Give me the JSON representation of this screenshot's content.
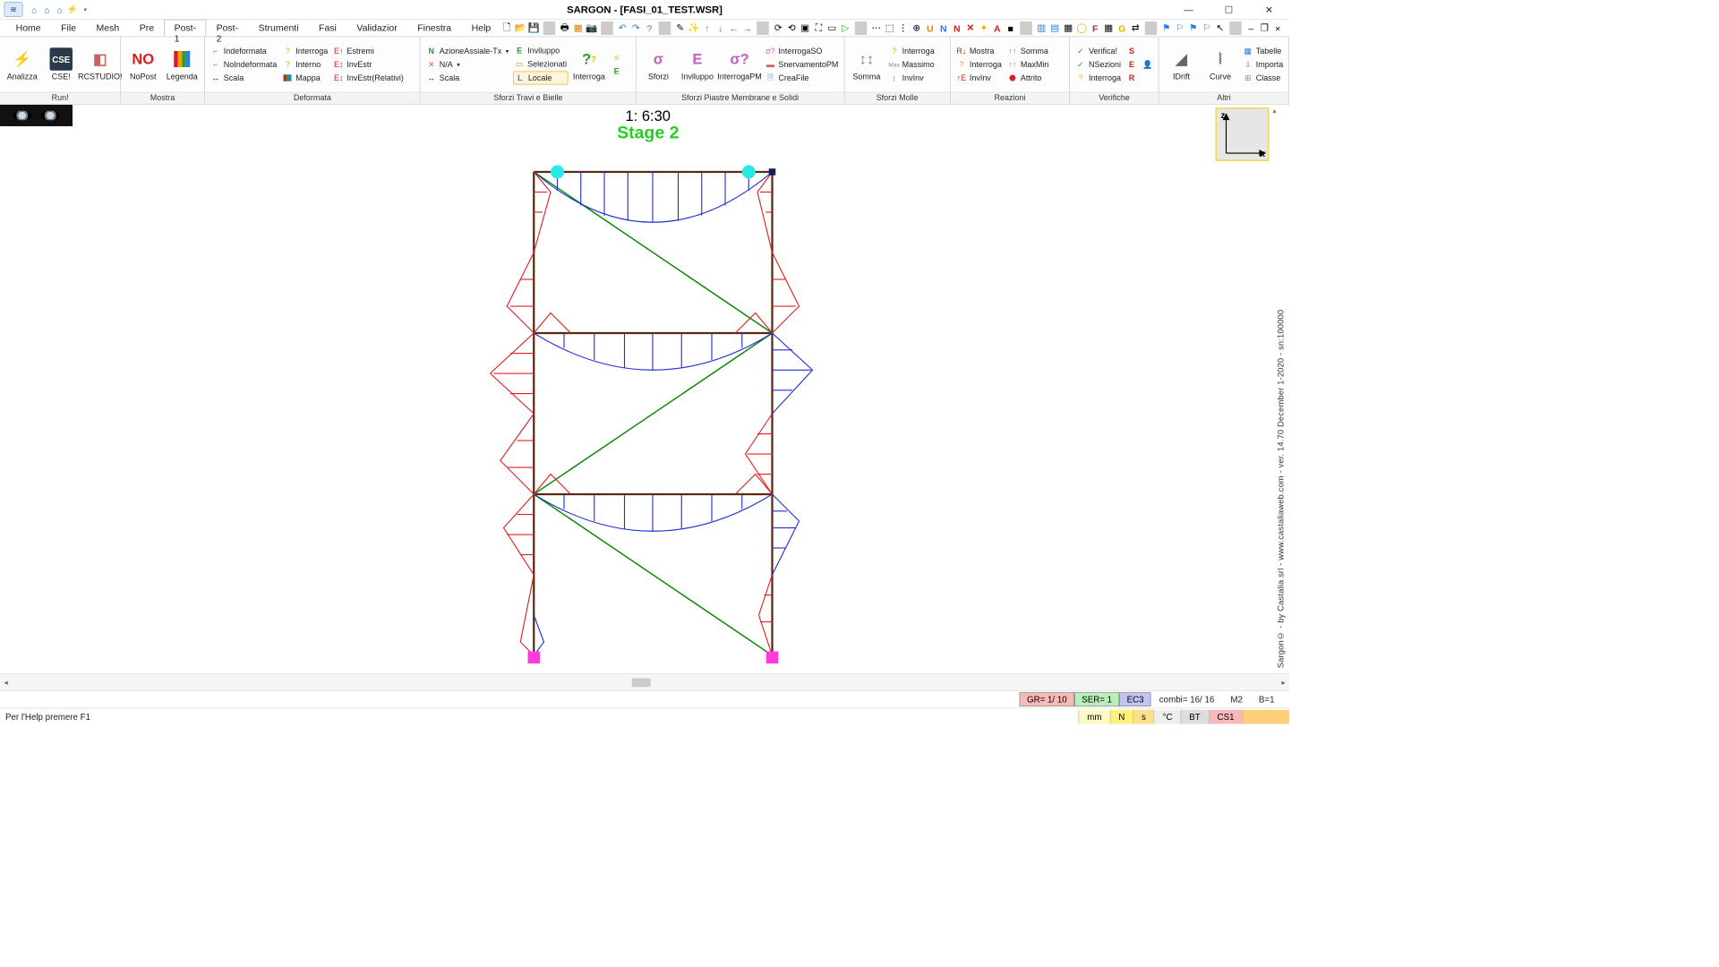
{
  "title": "SARGON - [FASI_01_TEST.WSR]",
  "menu": [
    "Home",
    "File",
    "Mesh",
    "Pre",
    "Post-1",
    "Post-2",
    "Strumenti",
    "Fasi",
    "Validazior",
    "Finestra",
    "Help"
  ],
  "menu_active": "Post-1",
  "groups": {
    "run": {
      "label": "Run!",
      "btns": [
        "Analizza",
        "CSE!",
        "RCSTUDIO!"
      ]
    },
    "mostra": {
      "label": "Mostra",
      "btns": [
        "NoPost",
        "Legenda"
      ]
    },
    "deformata": {
      "label": "Deformata",
      "c1": [
        "Indeformata",
        "NoIndeformata",
        "Scala"
      ],
      "c2": [
        "Interroga",
        "Interno",
        "Mappa"
      ],
      "c3": [
        "Estremi",
        "InvEstr",
        "InvEstr(Relativi)"
      ]
    },
    "sforzi_tb": {
      "label": "Sforzi Travi e Bielle",
      "c1": [
        "AzioneAssiale-Tx",
        "N/A",
        "Scala"
      ],
      "c2": [
        "Inviluppo",
        "Selezionati",
        "Locale"
      ],
      "big": "Interroga"
    },
    "sforzi_pm": {
      "label": "Sforzi Piastre Membrane e Solidi",
      "btns": [
        "Sforzi",
        "Inviluppo",
        "InterrogaPM"
      ],
      "c1": [
        "InterrogaSO",
        "SnervamentoPM",
        "CreaFile"
      ]
    },
    "sforzi_molle": {
      "label": "Sforzi Molle",
      "big": "Somma",
      "c1": [
        "Interroga",
        "Massimo",
        "InvInv"
      ]
    },
    "reazioni": {
      "label": "Reazioni",
      "c1": [
        "Mostra",
        "Interroga",
        "InvInv"
      ],
      "c2": [
        "Somma",
        "MaxMin",
        "Attrito"
      ]
    },
    "verifiche": {
      "label": "Verifiche",
      "c1": [
        "Verifica!",
        "NSezioni",
        "Interroga"
      ]
    },
    "altri": {
      "label": "Altri",
      "btns": [
        "IDrift",
        "Curve"
      ],
      "c1": [
        "Tabelle",
        "Importa",
        "Classe"
      ]
    }
  },
  "viewport": {
    "time": "1: 6:30",
    "stage": "Stage 2",
    "axis_z": "z",
    "axis_x": "x"
  },
  "side_text": "Sargon© - by Castalia srl - www.castaliaweb.com - ver. 14.70 December 1-2020 - sn:100000",
  "status1": {
    "gr": "GR=  1/ 10",
    "ser": "SER= 1",
    "norm": "EC3",
    "combi": "combi=  16/  16",
    "m": "M2",
    "b": "B=1"
  },
  "status2": {
    "help": "Per l'Help premere F1",
    "cells": [
      "mm",
      "N",
      "s",
      "°C",
      "BT",
      "CS1"
    ]
  }
}
